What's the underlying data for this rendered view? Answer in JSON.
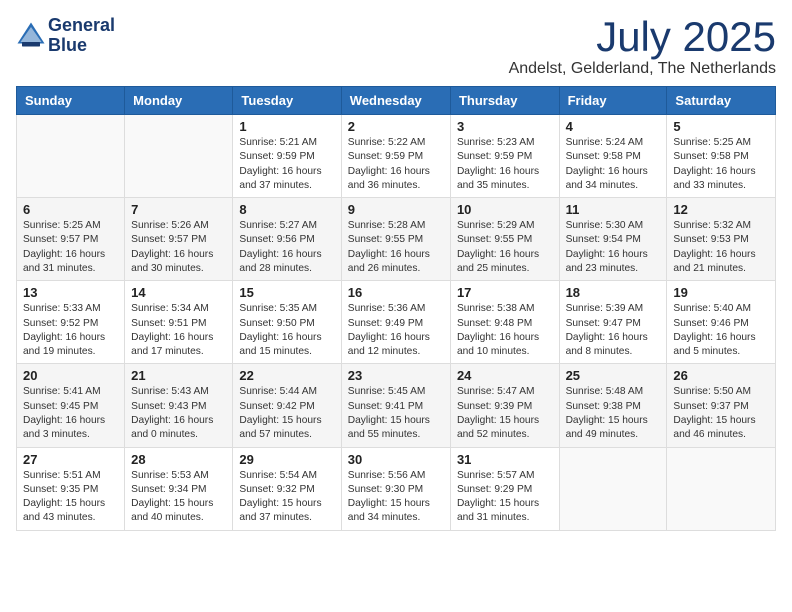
{
  "logo": {
    "line1": "General",
    "line2": "Blue"
  },
  "title": "July 2025",
  "location": "Andelst, Gelderland, The Netherlands",
  "days_of_week": [
    "Sunday",
    "Monday",
    "Tuesday",
    "Wednesday",
    "Thursday",
    "Friday",
    "Saturday"
  ],
  "weeks": [
    [
      {
        "day": "",
        "info": ""
      },
      {
        "day": "",
        "info": ""
      },
      {
        "day": "1",
        "info": "Sunrise: 5:21 AM\nSunset: 9:59 PM\nDaylight: 16 hours\nand 37 minutes."
      },
      {
        "day": "2",
        "info": "Sunrise: 5:22 AM\nSunset: 9:59 PM\nDaylight: 16 hours\nand 36 minutes."
      },
      {
        "day": "3",
        "info": "Sunrise: 5:23 AM\nSunset: 9:59 PM\nDaylight: 16 hours\nand 35 minutes."
      },
      {
        "day": "4",
        "info": "Sunrise: 5:24 AM\nSunset: 9:58 PM\nDaylight: 16 hours\nand 34 minutes."
      },
      {
        "day": "5",
        "info": "Sunrise: 5:25 AM\nSunset: 9:58 PM\nDaylight: 16 hours\nand 33 minutes."
      }
    ],
    [
      {
        "day": "6",
        "info": "Sunrise: 5:25 AM\nSunset: 9:57 PM\nDaylight: 16 hours\nand 31 minutes."
      },
      {
        "day": "7",
        "info": "Sunrise: 5:26 AM\nSunset: 9:57 PM\nDaylight: 16 hours\nand 30 minutes."
      },
      {
        "day": "8",
        "info": "Sunrise: 5:27 AM\nSunset: 9:56 PM\nDaylight: 16 hours\nand 28 minutes."
      },
      {
        "day": "9",
        "info": "Sunrise: 5:28 AM\nSunset: 9:55 PM\nDaylight: 16 hours\nand 26 minutes."
      },
      {
        "day": "10",
        "info": "Sunrise: 5:29 AM\nSunset: 9:55 PM\nDaylight: 16 hours\nand 25 minutes."
      },
      {
        "day": "11",
        "info": "Sunrise: 5:30 AM\nSunset: 9:54 PM\nDaylight: 16 hours\nand 23 minutes."
      },
      {
        "day": "12",
        "info": "Sunrise: 5:32 AM\nSunset: 9:53 PM\nDaylight: 16 hours\nand 21 minutes."
      }
    ],
    [
      {
        "day": "13",
        "info": "Sunrise: 5:33 AM\nSunset: 9:52 PM\nDaylight: 16 hours\nand 19 minutes."
      },
      {
        "day": "14",
        "info": "Sunrise: 5:34 AM\nSunset: 9:51 PM\nDaylight: 16 hours\nand 17 minutes."
      },
      {
        "day": "15",
        "info": "Sunrise: 5:35 AM\nSunset: 9:50 PM\nDaylight: 16 hours\nand 15 minutes."
      },
      {
        "day": "16",
        "info": "Sunrise: 5:36 AM\nSunset: 9:49 PM\nDaylight: 16 hours\nand 12 minutes."
      },
      {
        "day": "17",
        "info": "Sunrise: 5:38 AM\nSunset: 9:48 PM\nDaylight: 16 hours\nand 10 minutes."
      },
      {
        "day": "18",
        "info": "Sunrise: 5:39 AM\nSunset: 9:47 PM\nDaylight: 16 hours\nand 8 minutes."
      },
      {
        "day": "19",
        "info": "Sunrise: 5:40 AM\nSunset: 9:46 PM\nDaylight: 16 hours\nand 5 minutes."
      }
    ],
    [
      {
        "day": "20",
        "info": "Sunrise: 5:41 AM\nSunset: 9:45 PM\nDaylight: 16 hours\nand 3 minutes."
      },
      {
        "day": "21",
        "info": "Sunrise: 5:43 AM\nSunset: 9:43 PM\nDaylight: 16 hours\nand 0 minutes."
      },
      {
        "day": "22",
        "info": "Sunrise: 5:44 AM\nSunset: 9:42 PM\nDaylight: 15 hours\nand 57 minutes."
      },
      {
        "day": "23",
        "info": "Sunrise: 5:45 AM\nSunset: 9:41 PM\nDaylight: 15 hours\nand 55 minutes."
      },
      {
        "day": "24",
        "info": "Sunrise: 5:47 AM\nSunset: 9:39 PM\nDaylight: 15 hours\nand 52 minutes."
      },
      {
        "day": "25",
        "info": "Sunrise: 5:48 AM\nSunset: 9:38 PM\nDaylight: 15 hours\nand 49 minutes."
      },
      {
        "day": "26",
        "info": "Sunrise: 5:50 AM\nSunset: 9:37 PM\nDaylight: 15 hours\nand 46 minutes."
      }
    ],
    [
      {
        "day": "27",
        "info": "Sunrise: 5:51 AM\nSunset: 9:35 PM\nDaylight: 15 hours\nand 43 minutes."
      },
      {
        "day": "28",
        "info": "Sunrise: 5:53 AM\nSunset: 9:34 PM\nDaylight: 15 hours\nand 40 minutes."
      },
      {
        "day": "29",
        "info": "Sunrise: 5:54 AM\nSunset: 9:32 PM\nDaylight: 15 hours\nand 37 minutes."
      },
      {
        "day": "30",
        "info": "Sunrise: 5:56 AM\nSunset: 9:30 PM\nDaylight: 15 hours\nand 34 minutes."
      },
      {
        "day": "31",
        "info": "Sunrise: 5:57 AM\nSunset: 9:29 PM\nDaylight: 15 hours\nand 31 minutes."
      },
      {
        "day": "",
        "info": ""
      },
      {
        "day": "",
        "info": ""
      }
    ]
  ]
}
